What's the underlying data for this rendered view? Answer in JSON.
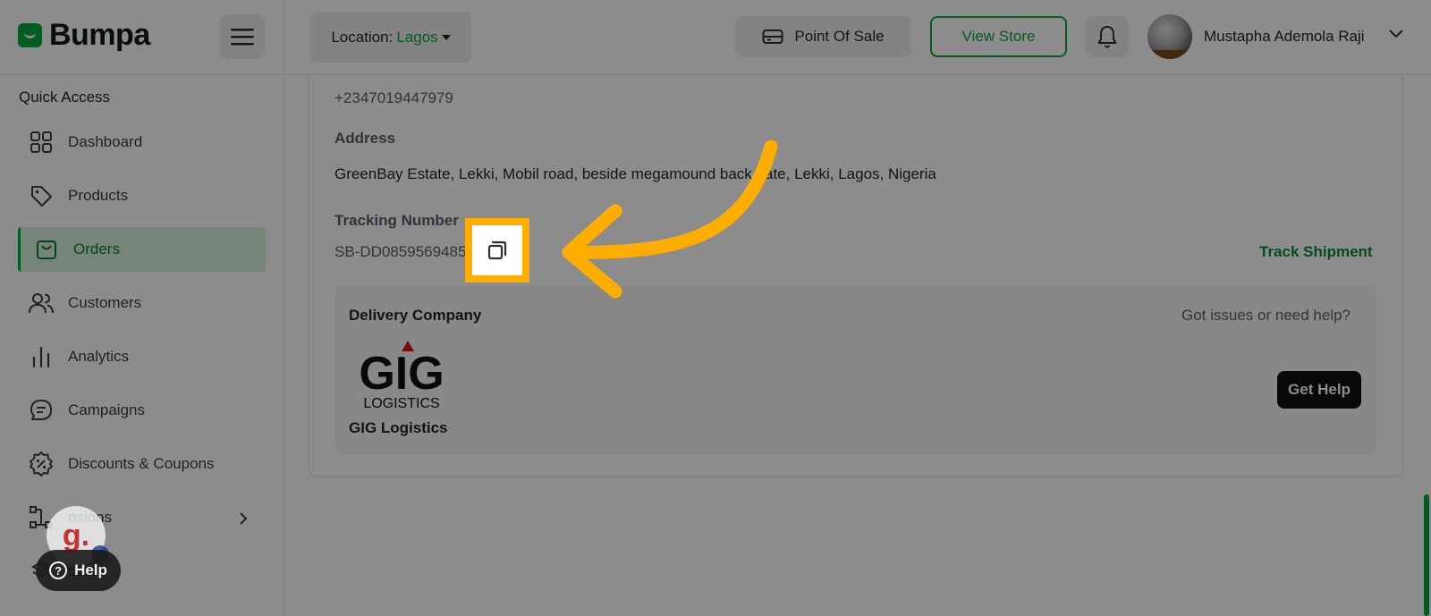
{
  "brand": {
    "name": "Bumpa"
  },
  "header": {
    "location_label": "Location:",
    "location_value": "Lagos",
    "pos_label": "Point Of Sale",
    "view_store_label": "View Store",
    "user_name": "Mustapha Ademola Raji"
  },
  "sidebar": {
    "title": "Quick Access",
    "items": [
      {
        "label": "Dashboard",
        "icon": "grid-icon"
      },
      {
        "label": "Products",
        "icon": "tag-icon"
      },
      {
        "label": "Orders",
        "icon": "bag-icon",
        "active": true
      },
      {
        "label": "Customers",
        "icon": "users-icon"
      },
      {
        "label": "Analytics",
        "icon": "bar-chart-icon"
      },
      {
        "label": "Campaigns",
        "icon": "chat-icon"
      },
      {
        "label": "Discounts & Coupons",
        "icon": "discount-icon"
      },
      {
        "label": "nsions",
        "icon": "extensions-icon"
      },
      {
        "label": "ctions",
        "icon": "collections-icon"
      }
    ]
  },
  "order": {
    "phone": "+2347019447979",
    "address_label": "Address",
    "address_value": "GreenBay Estate, Lekki, Mobil road, beside megamound back gate, Lekki, Lagos, Nigeria",
    "tracking_label": "Tracking Number",
    "tracking_value": "SB-DD0859569485",
    "track_link": "Track Shipment"
  },
  "delivery": {
    "title": "Delivery Company",
    "help_text": "Got issues or need help?",
    "company_name": "GIG Logistics",
    "logo_text_top": "GIG",
    "logo_text_bottom": "LOGISTICS",
    "get_help_label": "Get Help"
  },
  "widgets": {
    "badge_letter": "g.",
    "help_label": "Help"
  },
  "colors": {
    "accent": "#0aa83f",
    "highlight": "#ffad00"
  }
}
